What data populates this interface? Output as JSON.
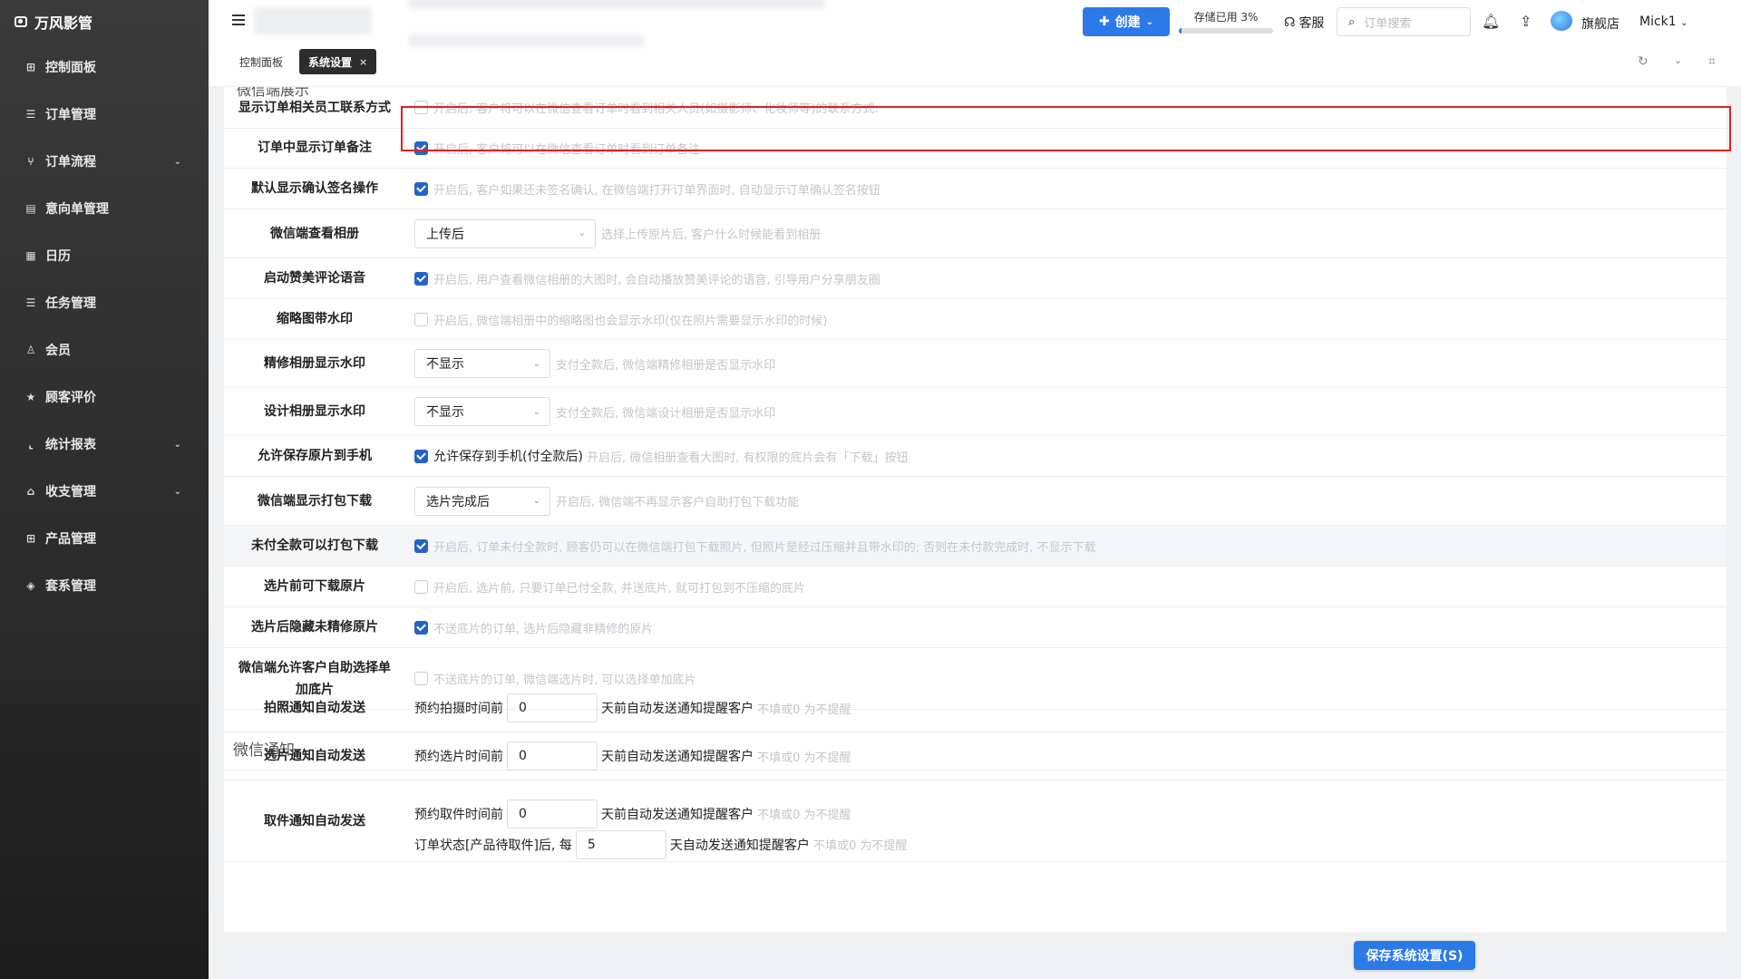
{
  "brand": {
    "name": "万风影管",
    "icon": "camera-icon"
  },
  "sidebar": {
    "items": [
      {
        "label": "控制面板",
        "icon": "grid-icon",
        "expandable": false
      },
      {
        "label": "订单管理",
        "icon": "list-icon",
        "expandable": false
      },
      {
        "label": "订单流程",
        "icon": "flow-icon",
        "expandable": true
      },
      {
        "label": "意向单管理",
        "icon": "document-icon",
        "expandable": false
      },
      {
        "label": "日历",
        "icon": "calendar-icon",
        "expandable": false
      },
      {
        "label": "任务管理",
        "icon": "list-icon",
        "expandable": false
      },
      {
        "label": "会员",
        "icon": "user-icon",
        "expandable": false
      },
      {
        "label": "顾客评价",
        "icon": "star-icon",
        "expandable": false
      },
      {
        "label": "统计报表",
        "icon": "chart-icon",
        "expandable": true
      },
      {
        "label": "收支管理",
        "icon": "bank-icon",
        "expandable": true
      },
      {
        "label": "产品管理",
        "icon": "grid-icon",
        "expandable": false
      },
      {
        "label": "套系管理",
        "icon": "package-icon",
        "expandable": false
      }
    ]
  },
  "header": {
    "create_label": "创建",
    "storage_label": "存储已用 3%",
    "storage_percent": 3,
    "service_label": "客服",
    "search_placeholder": "订单搜索",
    "shop_label": "旗舰店",
    "user_label": "Mick1"
  },
  "tabs": {
    "items": [
      "控制面板",
      "系统设置"
    ],
    "active": "系统设置",
    "close_glyph": "×"
  },
  "settings": {
    "section_cut": "微信端展示",
    "rows": [
      {
        "label": "显示订单相关员工联系方式",
        "checked": false,
        "hint": "开启后, 客户将可以在微信查看订单时看到相关人员(如摄影师、化妆师等)的联系方式."
      },
      {
        "label": "订单中显示订单备注",
        "checked": true,
        "hint": "开启后, 客户将可以在微信查看订单时看到订单备注"
      },
      {
        "label": "默认显示确认签名操作",
        "checked": true,
        "hint": "开启后, 客户如果还未签名确认, 在微信端打开订单界面时, 自动显示订单确认签名按钮"
      },
      {
        "label": "微信端查看相册",
        "select": "上传后",
        "hint": "选择上传原片后, 客户什么时候能看到相册"
      },
      {
        "label": "启动赞美评论语音",
        "checked": true,
        "hint": "开启后, 用户查看微信相册的大图时, 会自动播放赞美评论的语音, 引导用户分享朋友圈"
      },
      {
        "label": "缩略图带水印",
        "checked": false,
        "hint": "开启后, 微信端相册中的缩略图也会显示水印(仅在照片需要显示水印的时候)"
      },
      {
        "label": "精修相册显示水印",
        "select": "不显示",
        "hint": "支付全款后, 微信端精修相册是否显示水印"
      },
      {
        "label": "设计相册显示水印",
        "select": "不显示",
        "hint": "支付全款后, 微信端设计相册是否显示水印"
      },
      {
        "label": "允许保存原片到手机",
        "checked": true,
        "strong": "允许保存到手机(付全款后)",
        "hint": "开启后, 微信相册查看大图时, 有权限的底片会有「下载」按钮"
      },
      {
        "label": "微信端显示打包下载",
        "select": "选片完成后",
        "hint": "开启后, 微信端不再显示客户自助打包下载功能"
      },
      {
        "label": "未付全款可以打包下载",
        "checked": true,
        "hint": "开启后, 订单未付全款时, 顾客仍可以在微信端打包下载照片, 但照片是经过压缩并且带水印的; 否则在未付款完成时, 不显示下载"
      },
      {
        "label": "选片前可下载原片",
        "checked": false,
        "hint": "开启后, 选片前, 只要订单已付全款, 并送底片, 就可打包到不压缩的底片"
      },
      {
        "label": "选片后隐藏未精修原片",
        "checked": true,
        "hint": "不送底片的订单, 选片后隐藏非精修的原片"
      },
      {
        "label": "微信端允许客户自助选择单加底片",
        "checked": false,
        "hint": "不送底片的订单, 微信端选片时, 可以选择单加底片"
      }
    ],
    "notify_title": "微信通知",
    "notify_rows": [
      {
        "label": "拍照通知自动发送",
        "prefix": "预约拍摄时间前",
        "value": "0",
        "suffix": "天前自动发送通知提醒客户",
        "hint": "不填或0 为不提醒"
      },
      {
        "label": "选片通知自动发送",
        "prefix": "预约选片时间前",
        "value": "0",
        "suffix": "天前自动发送通知提醒客户",
        "hint": "不填或0 为不提醒"
      },
      {
        "label": "取件通知自动发送",
        "prefix": "预约取件时间前",
        "value": "0",
        "suffix": "天前自动发送通知提醒客户",
        "hint": "不填或0 为不提醒",
        "prefix2": "订单状态[产品待取件]后, 每",
        "value2": "5",
        "suffix2": "天自动发送通知提醒客户",
        "hint2": "不填或0 为不提醒"
      }
    ]
  },
  "footer": {
    "save_label": "保存系统设置(S)"
  },
  "colors": {
    "accent": "#2b7ae8",
    "checkbox": "#2563c9",
    "highlight": "#e02020",
    "sidebar": "#2b2b2b"
  }
}
